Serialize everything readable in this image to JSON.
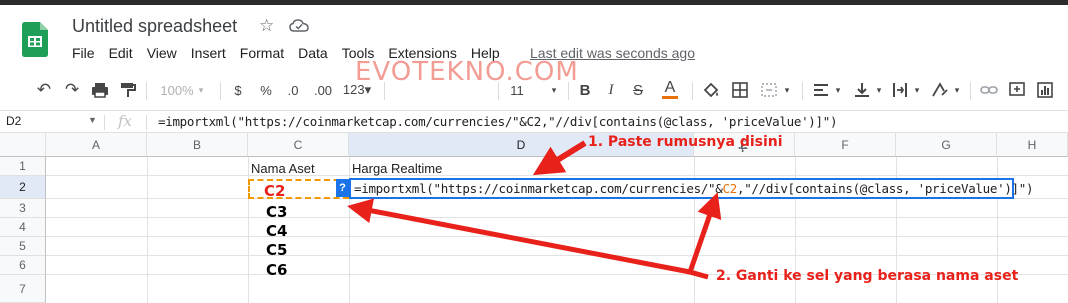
{
  "app": {
    "title": "Untitled spreadsheet",
    "last_edit": "Last edit was seconds ago",
    "watermark": "EVOTEKNO.COM"
  },
  "menu": [
    "File",
    "Edit",
    "View",
    "Insert",
    "Format",
    "Data",
    "Tools",
    "Extensions",
    "Help"
  ],
  "toolbar": {
    "zoom": "100%",
    "currency": "$",
    "percent": "%",
    "dec_decrease": ".0",
    "dec_increase": ".00",
    "number_format": "123▾",
    "font_size": "11",
    "bold": "B",
    "italic": "I",
    "strikethrough": "S",
    "text_color": "A"
  },
  "formula_bar": {
    "name_box": "D2",
    "fx": "fx",
    "formula": "=importxml(\"https://coinmarketcap.com/currencies/\"&C2,\"//div[contains(@class, 'priceValue')]\")"
  },
  "columns": [
    "A",
    "B",
    "C",
    "D",
    "E",
    "F",
    "G",
    "H"
  ],
  "rows": [
    "1",
    "2",
    "3",
    "4",
    "5",
    "6",
    "7"
  ],
  "cells": {
    "c1": "Nama Aset",
    "d1": "Harga Realtime",
    "c2": "C2",
    "c3": "C3",
    "c4": "C4",
    "c5": "C5",
    "c6": "C6"
  },
  "edit": {
    "help": "?",
    "part1": "=importxml(\"https://coinmarketcap.com/currencies/\"&",
    "ref": "C2",
    "part2": ",\"//div[contains(@class, 'priceValue')]\")"
  },
  "annotations": {
    "step1": "1. Paste rumusnya disini",
    "step2": "2. Ganti ke sel yang berasa nama aset"
  },
  "colors": {
    "annotation_red": "#e8211b",
    "edit_border": "#1a73e8",
    "ref_orange": "#e8710a",
    "copy_border": "#f29900"
  }
}
